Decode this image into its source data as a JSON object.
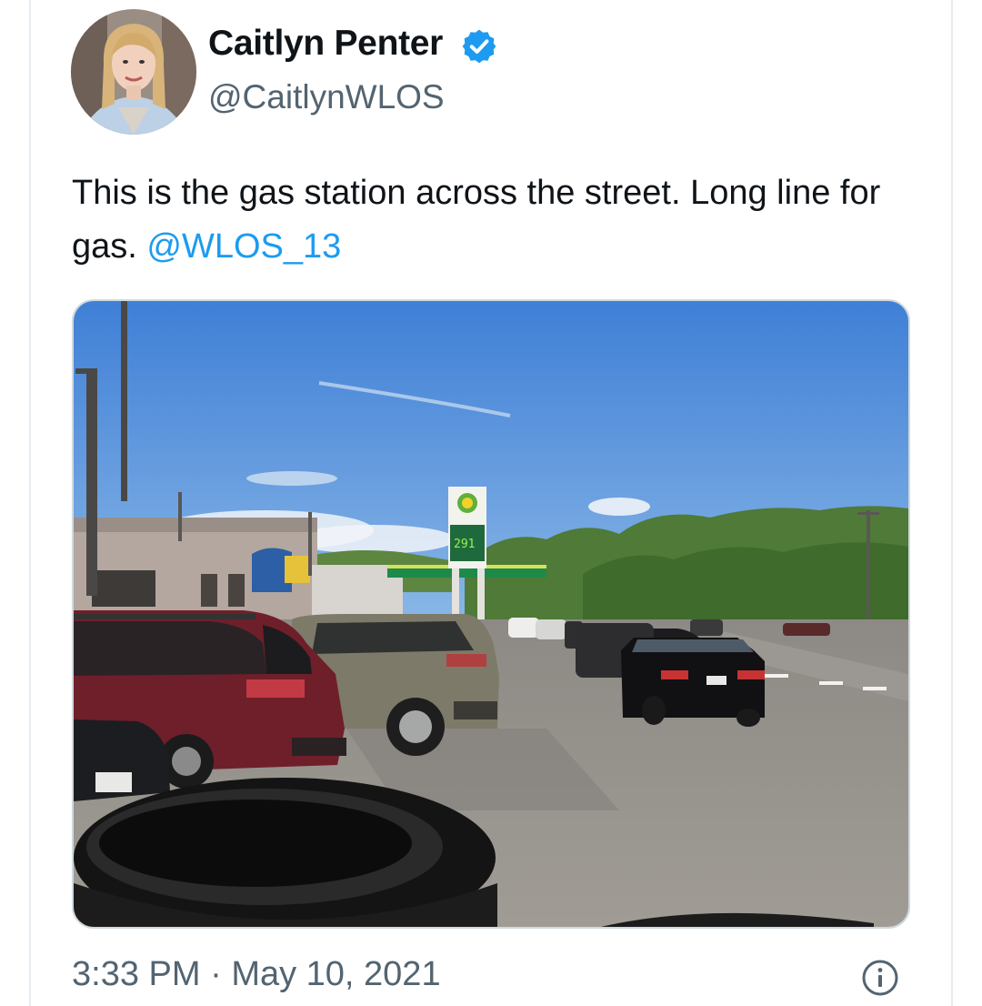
{
  "tweet": {
    "author": {
      "display_name": "Caitlyn Penter",
      "handle": "@CaitlynWLOS",
      "verified": true,
      "avatar_icon": "profile-photo"
    },
    "text": "This is the gas station across the street. Long line for gas. ",
    "mention": "@WLOS_13",
    "media": {
      "kind": "photo",
      "price_sign": "291"
    },
    "time": "3:33 PM",
    "separator": "·",
    "date": "May 10, 2021",
    "info_icon": "info-icon"
  },
  "colors": {
    "text": "#0f1419",
    "secondary": "#536471",
    "link": "#1d9bf0",
    "verified": "#1d9bf0",
    "border": "#cfd9de"
  }
}
